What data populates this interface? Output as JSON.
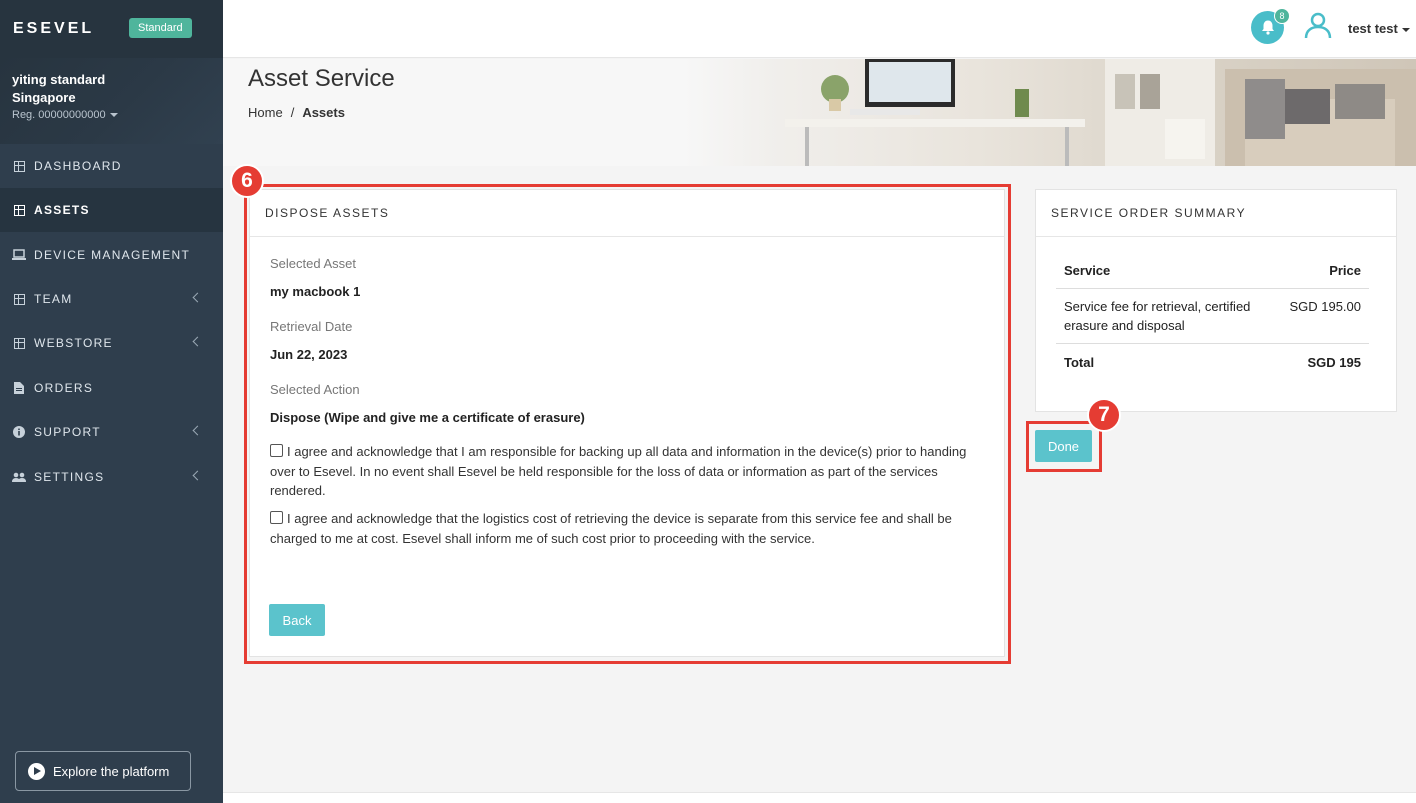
{
  "sidebar": {
    "brand": "ESEVEL",
    "plan_badge": "Standard",
    "org_name": "yiting standard Singapore",
    "org_reg": "Reg. 00000000000",
    "items": [
      {
        "label": "DASHBOARD",
        "icon": "grid-icon"
      },
      {
        "label": "ASSETS",
        "icon": "grid-icon",
        "active": true
      },
      {
        "label": "DEVICE MANAGEMENT",
        "icon": "laptop-icon"
      },
      {
        "label": "TEAM",
        "icon": "grid-icon",
        "has_children": true
      },
      {
        "label": "WEBSTORE",
        "icon": "grid-icon",
        "has_children": true
      },
      {
        "label": "ORDERS",
        "icon": "document-icon"
      },
      {
        "label": "SUPPORT",
        "icon": "info-icon",
        "has_children": true
      },
      {
        "label": "SETTINGS",
        "icon": "users-cog-icon",
        "has_children": true
      }
    ],
    "explore_label": "Explore the platform"
  },
  "topbar": {
    "notification_count": "8",
    "user_name": "test test"
  },
  "header": {
    "title": "Asset Service",
    "breadcrumb": {
      "home": "Home",
      "sep": "/",
      "current": "Assets"
    }
  },
  "dispose": {
    "title": "DISPOSE ASSETS",
    "selected_asset_label": "Selected Asset",
    "selected_asset_value": "my macbook 1",
    "retrieval_date_label": "Retrieval Date",
    "retrieval_date_value": "Jun 22, 2023",
    "selected_action_label": "Selected Action",
    "selected_action_value": "Dispose (Wipe and give me a certificate of erasure)",
    "agree_1": "I agree and acknowledge that I am responsible for backing up all data and information in the device(s) prior to handing over to Esevel. In no event shall Esevel be held responsible for the loss of data or information as part of the services rendered.",
    "agree_2": "I agree and acknowledge that the logistics cost of retrieving the device is separate from this service fee and shall be charged to me at cost. Esevel shall inform me of such cost prior to proceeding with the service.",
    "back_label": "Back"
  },
  "summary": {
    "title": "SERVICE ORDER SUMMARY",
    "col_service": "Service",
    "col_price": "Price",
    "row_service": "Service fee for retrieval, certified erasure and disposal",
    "row_price": "SGD 195.00",
    "total_label": "Total",
    "total_value": "SGD 195"
  },
  "done_label": "Done",
  "annotations": {
    "step6": "6",
    "step7": "7",
    "color": "#e53c33"
  }
}
